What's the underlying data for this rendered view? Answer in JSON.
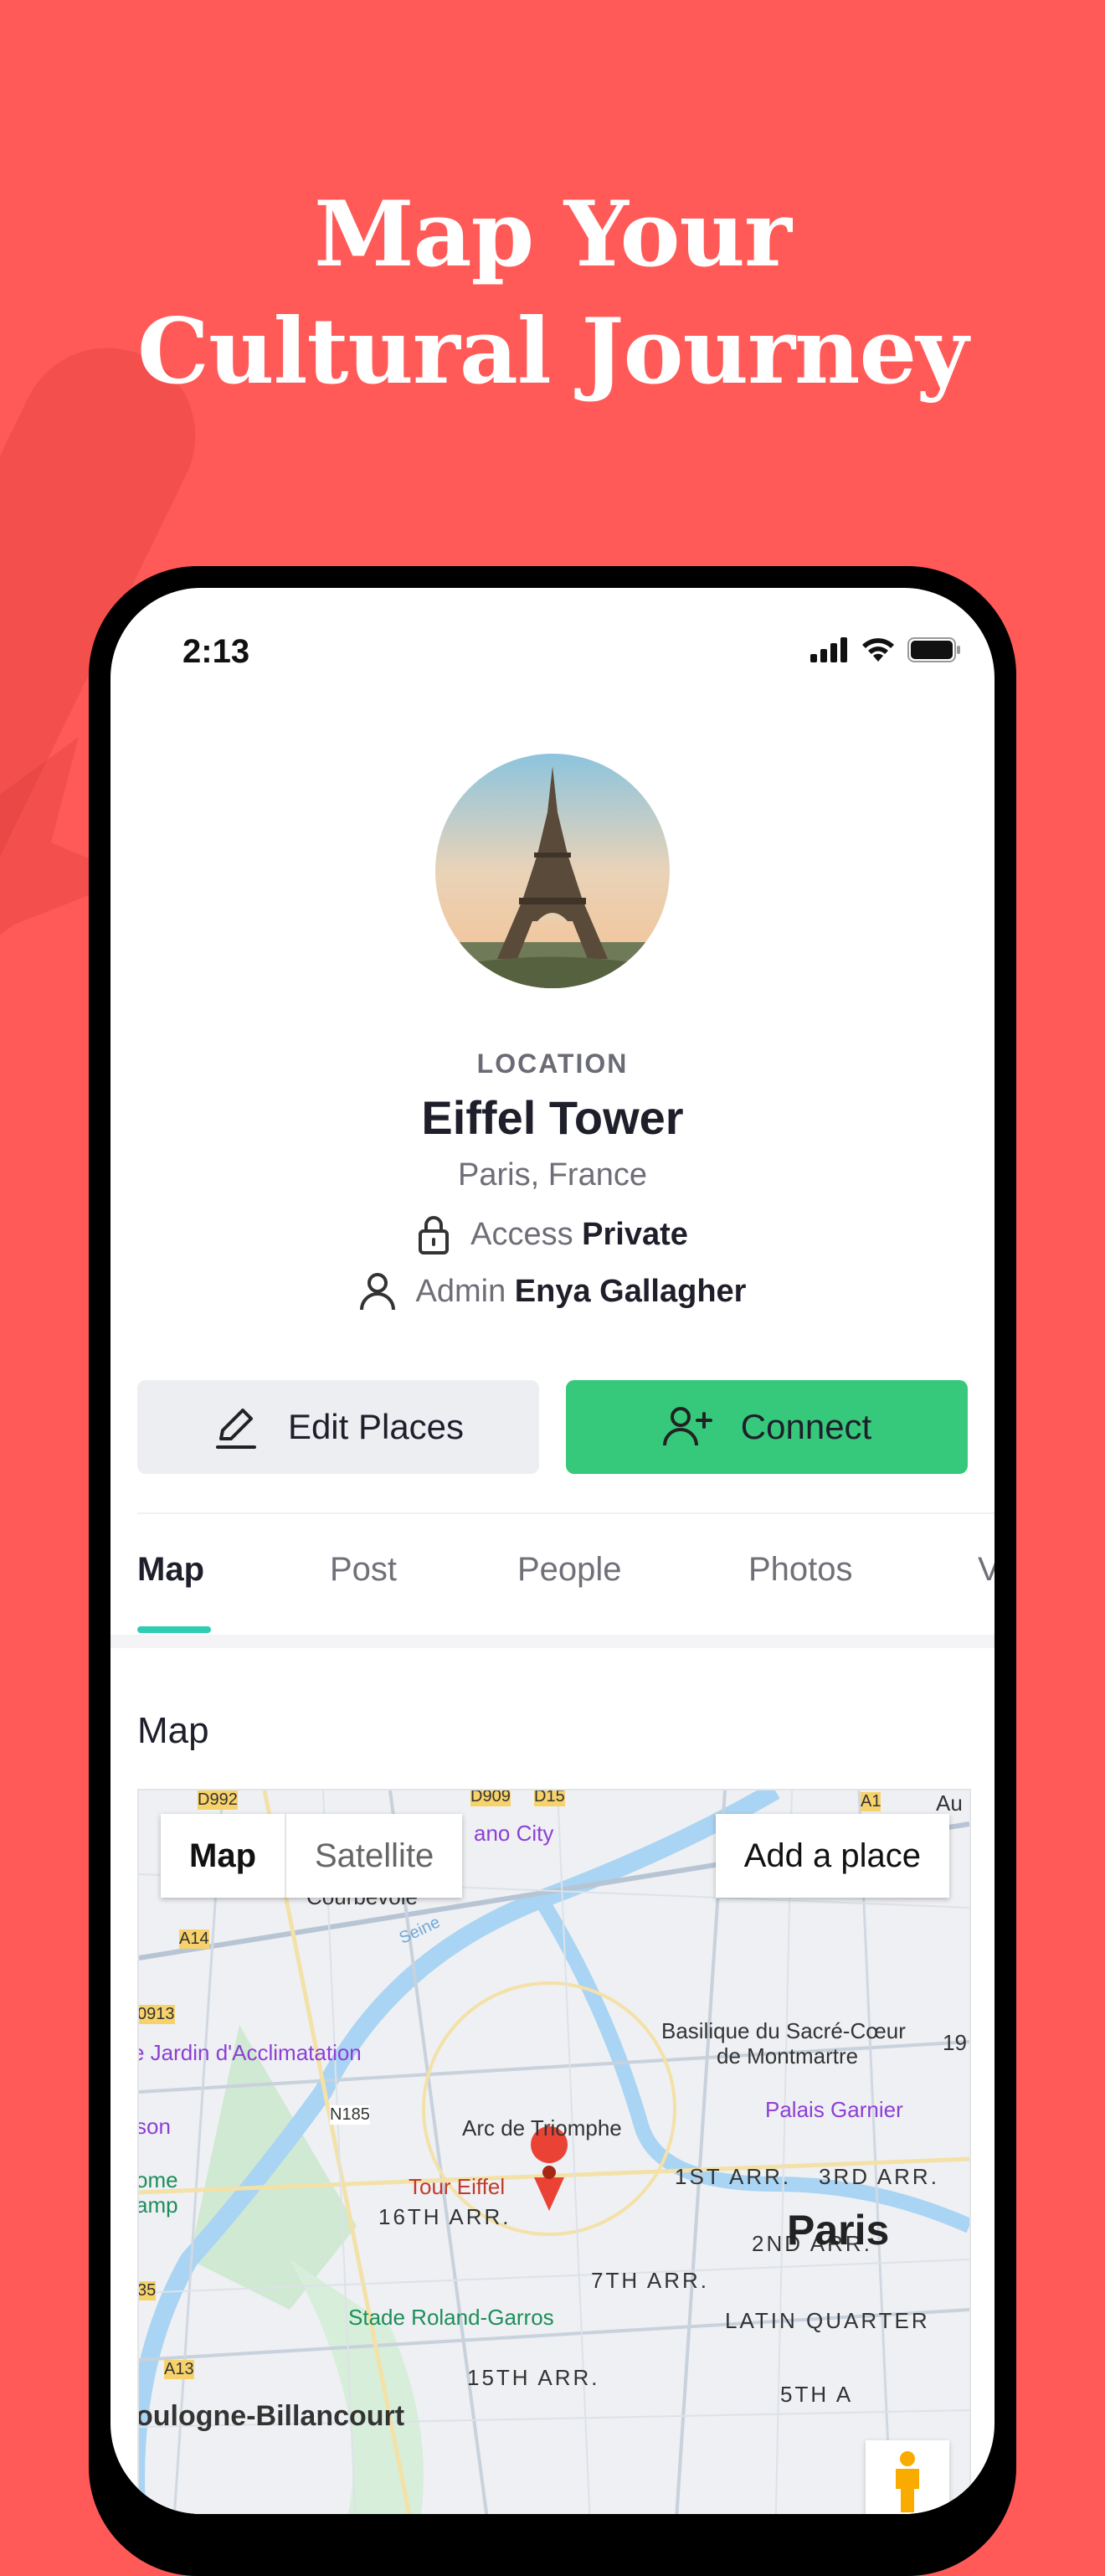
{
  "headline": {
    "line1": "Map Your",
    "line2": "Cultural Journey"
  },
  "status_bar": {
    "time": "2:13"
  },
  "location": {
    "label": "LOCATION",
    "name": "Eiffel Tower",
    "subtitle": "Paris, France",
    "access_label": "Access",
    "access_value": "Private",
    "admin_label": "Admin",
    "admin_value": "Enya Gallagher"
  },
  "actions": {
    "edit_label": "Edit Places",
    "connect_label": "Connect"
  },
  "tabs": [
    {
      "label": "Map",
      "active": true
    },
    {
      "label": "Post"
    },
    {
      "label": "People"
    },
    {
      "label": "Photos"
    },
    {
      "label": "V"
    }
  ],
  "section": {
    "title": "Map"
  },
  "map": {
    "mode_map": "Map",
    "mode_satellite": "Satellite",
    "add_place": "Add a place",
    "labels": {
      "courbevoie": "Courbevoie",
      "jardin": "e Jardin d'Acclimatation",
      "basilique_1": "Basilique du Sacré-Cœur",
      "basilique_2": "de Montmartre",
      "palais": "Palais Garnier",
      "arc": "Arc de Triomphe",
      "tour": "Tour Eiffel",
      "arr16": "16TH ARR.",
      "arr1": "1ST ARR.",
      "arr3": "3RD ARR.",
      "arr2": "2ND ARR.",
      "arr7": "7TH ARR.",
      "paris": "Paris",
      "latin": "LATIN QUARTER",
      "stade": "Stade Roland-Garros",
      "arr15": "15TH ARR.",
      "arr5": "5TH A",
      "boulogne": "oulogne-Billancourt",
      "nano": "ano City",
      "camp": "ome\namp",
      "son": "son",
      "au": "Au",
      "n185": "N185",
      "a14": "A14",
      "a13": "A13",
      "d992": "D992",
      "d909": "D909",
      "d15": "D15",
      "a1": "A1",
      "n913": "0913",
      "n19": "19",
      "n35": "35",
      "seine": "Seine"
    }
  },
  "colors": {
    "background": "#FF5A57",
    "connect": "#36C97B",
    "tab_accent": "#2ECCB0",
    "edit_bg": "#EDEEF1"
  }
}
